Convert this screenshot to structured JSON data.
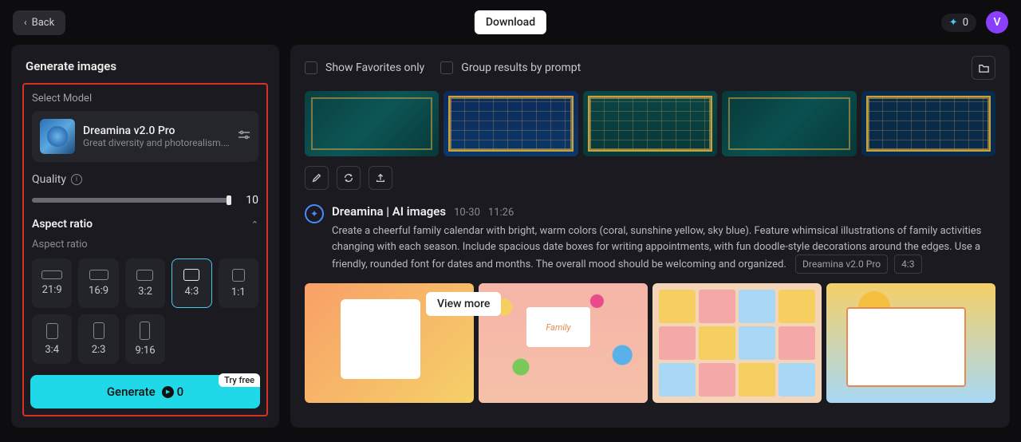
{
  "topbar": {
    "back_label": "Back",
    "download_label": "Download",
    "credits": "0",
    "avatar_initial": "V"
  },
  "sidebar": {
    "title": "Generate images",
    "select_model_label": "Select Model",
    "model": {
      "name": "Dreamina v2.0 Pro",
      "desc": "Great diversity and photorealism. Of..."
    },
    "quality_label": "Quality",
    "quality_value": "10",
    "aspect_title": "Aspect ratio",
    "aspect_sub": "Aspect ratio",
    "ratios": [
      "21:9",
      "16:9",
      "3:2",
      "4:3",
      "1:1",
      "3:4",
      "2:3",
      "9:16"
    ],
    "generate_label": "Generate",
    "generate_cost": "0",
    "try_free_label": "Try free"
  },
  "content": {
    "show_favorites_label": "Show Favorites only",
    "group_label": "Group results by prompt",
    "prompt": {
      "source": "Dreamina | AI images",
      "date": "10-30",
      "time": "11:26",
      "body": "Create a cheerful family calendar with bright, warm colors (coral, sunshine yellow, sky blue). Feature whimsical illustrations of family activities changing with each season. Include spacious date boxes for writing appointments, with fun doodle-style decorations around the edges. Use a friendly, rounded font for dates and months. The overall mood should be welcoming and organized.",
      "model_tag": "Dreamina v2.0 Pro",
      "ratio_tag": "4:3"
    },
    "view_more_label": "View more",
    "family_badge": "Family"
  }
}
